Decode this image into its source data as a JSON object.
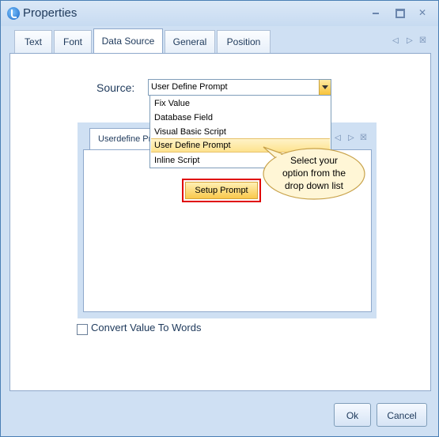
{
  "window": {
    "title": "Properties"
  },
  "tabs": [
    {
      "label": "Text"
    },
    {
      "label": "Font"
    },
    {
      "label": "Data Source",
      "active": true
    },
    {
      "label": "General"
    },
    {
      "label": "Position"
    }
  ],
  "source": {
    "label": "Source:",
    "selected_value": "User Define Prompt",
    "options": [
      "Fix Value",
      "Database Field",
      "Visual Basic Script",
      "User Define Prompt",
      "Inline Script"
    ]
  },
  "inner": {
    "tab_label": "Userdefine Prompt"
  },
  "setup_button": {
    "label": "Setup Prompt"
  },
  "callout": {
    "line1": "Select your",
    "line2": "option from the",
    "line3": "drop down list"
  },
  "convert": {
    "label": "Convert Value To Words",
    "checked": false
  },
  "buttons": {
    "ok": "Ok",
    "cancel": "Cancel"
  },
  "colors": {
    "accent": "#f9c84c",
    "highlight_border": "#e00000",
    "frame": "#cfe0f3"
  }
}
